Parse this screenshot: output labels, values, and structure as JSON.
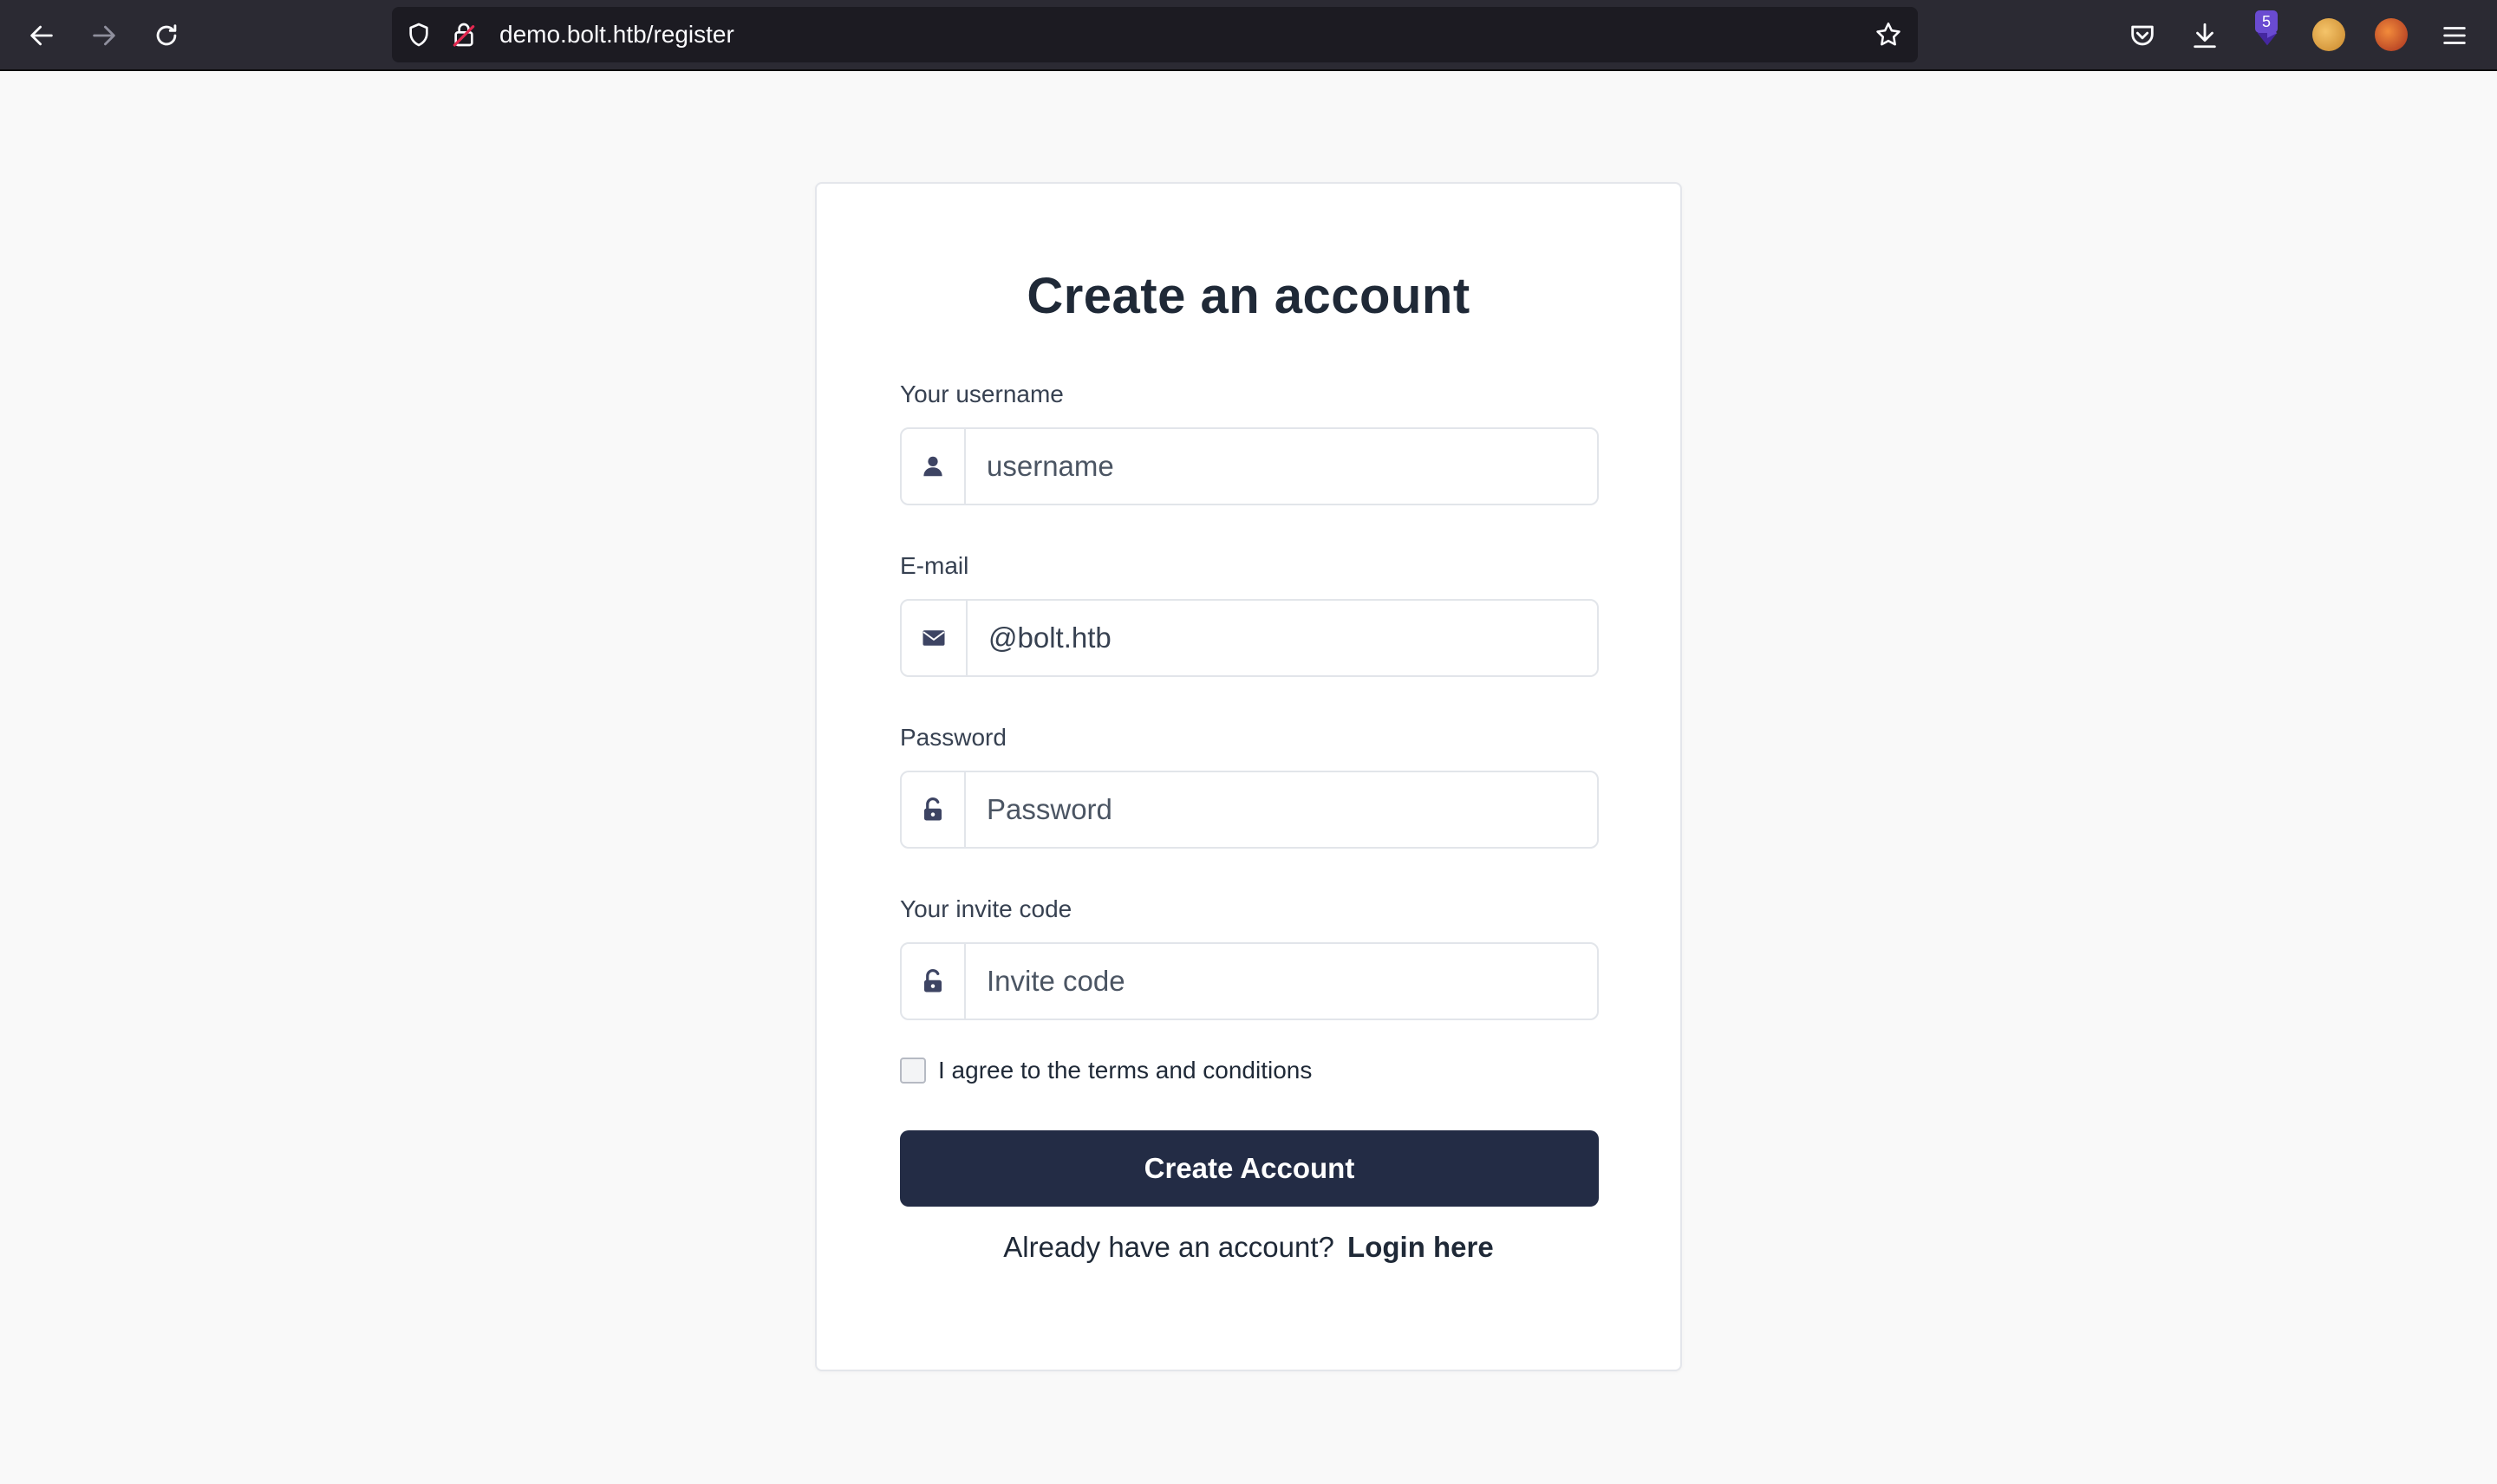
{
  "browser": {
    "url": "demo.bolt.htb/register",
    "extension_badge": "5"
  },
  "form": {
    "title": "Create an account",
    "username": {
      "label": "Your username",
      "placeholder": "username"
    },
    "email": {
      "label": "E-mail",
      "value": "@bolt.htb"
    },
    "password": {
      "label": "Password",
      "placeholder": "Password"
    },
    "invite": {
      "label": "Your invite code",
      "placeholder": "Invite code"
    },
    "terms": {
      "text": "I agree to the",
      "link": "terms and conditions"
    },
    "submit_label": "Create Account",
    "login_prompt": "Already have an account?",
    "login_link": "Login here"
  },
  "colors": {
    "button": "#232c45",
    "icon": "#3d4463",
    "chrome": "#2b2a33"
  }
}
